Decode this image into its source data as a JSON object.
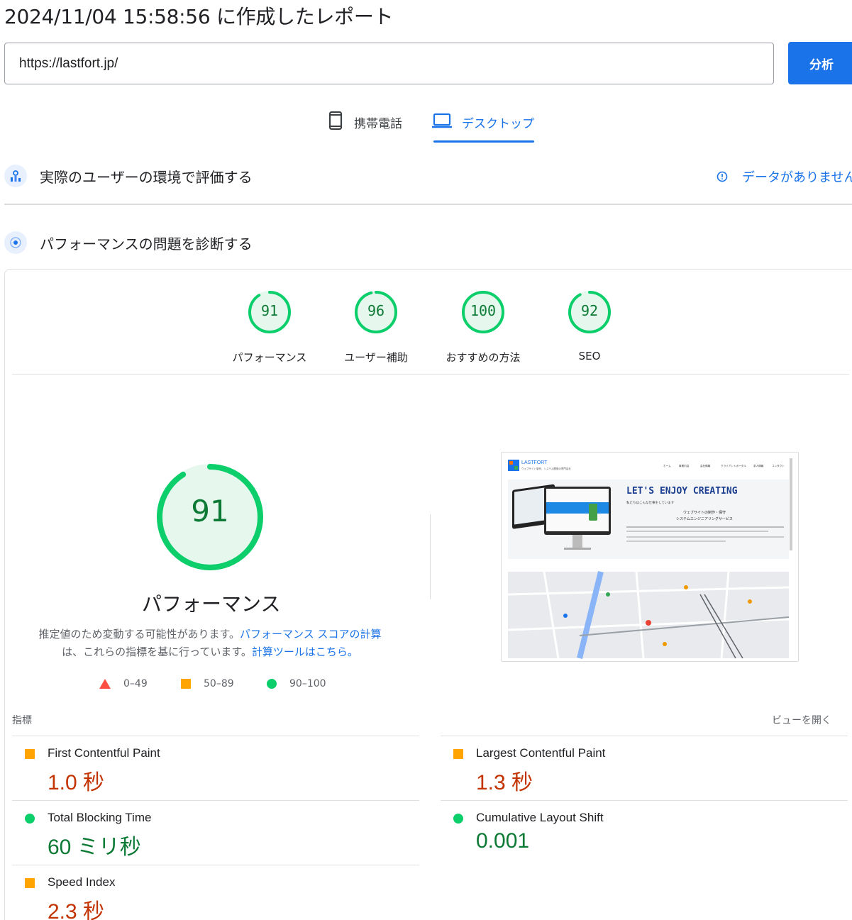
{
  "report": {
    "title": "2024/11/04 15:58:56 に作成したレポート"
  },
  "search": {
    "url": "https://lastfort.jp/",
    "analyze_label": "分析"
  },
  "tabs": [
    {
      "label": "携帯電話",
      "icon": "phone-icon",
      "active": false
    },
    {
      "label": "デスクトップ",
      "icon": "laptop-icon",
      "active": true
    }
  ],
  "field_data": {
    "title": "実際のユーザーの環境で評価する",
    "no_data": "データがありません"
  },
  "diagnose": {
    "title": "パフォーマンスの問題を診断する"
  },
  "categories": [
    {
      "label": "パフォーマンス",
      "score": "91"
    },
    {
      "label": "ユーザー補助",
      "score": "96"
    },
    {
      "label": "おすすめの方法",
      "score": "100"
    },
    {
      "label": "SEO",
      "score": "92"
    }
  ],
  "performance": {
    "score": "91",
    "label": "パフォーマンス",
    "desc_1": "推定値のため変動する可能性があります。",
    "desc_link_1": "パフォーマンス スコアの計算",
    "desc_2": "は、これらの指標を基に行っています。",
    "desc_link_2": "計算ツールはこちら。"
  },
  "legend": [
    {
      "range": "0–49",
      "shape": "triangle",
      "color": "#ff4e42"
    },
    {
      "range": "50–89",
      "shape": "square",
      "color": "#ffa400"
    },
    {
      "range": "90–100",
      "shape": "circle",
      "color": "#0cce6b"
    }
  ],
  "screenshot": {
    "brand": "LASTFORT",
    "tagline": "ウェブサイト制作、システム開発の専門会社",
    "nav": [
      "ホーム",
      "事業内容",
      "会社情報",
      "クライアントポータル",
      "求人情報",
      "コンタクト"
    ],
    "headline": "LET'S ENJOY CREATING",
    "sub": "私たちはこんな仕事をしています",
    "service_1": "ウェブサイトの制作・保守",
    "service_2": "システムエンジニアリングサービス"
  },
  "metrics": {
    "label": "指標",
    "expand": "ビューを開く",
    "items": [
      {
        "name": "First Contentful Paint",
        "value": "1.0 秒",
        "rating": "orange"
      },
      {
        "name": "Largest Contentful Paint",
        "value": "1.3 秒",
        "rating": "orange"
      },
      {
        "name": "Total Blocking Time",
        "value": "60 ミリ秒",
        "rating": "green"
      },
      {
        "name": "Cumulative Layout Shift",
        "value": "0.001",
        "rating": "green"
      },
      {
        "name": "Speed Index",
        "value": "2.3 秒",
        "rating": "orange"
      }
    ]
  },
  "colors": {
    "accent": "#1a73e8",
    "pass": "#0cce6b",
    "pass_text": "#0c7a34",
    "average": "#ffa400",
    "average_text": "#c33300",
    "fail": "#ff4e42"
  }
}
